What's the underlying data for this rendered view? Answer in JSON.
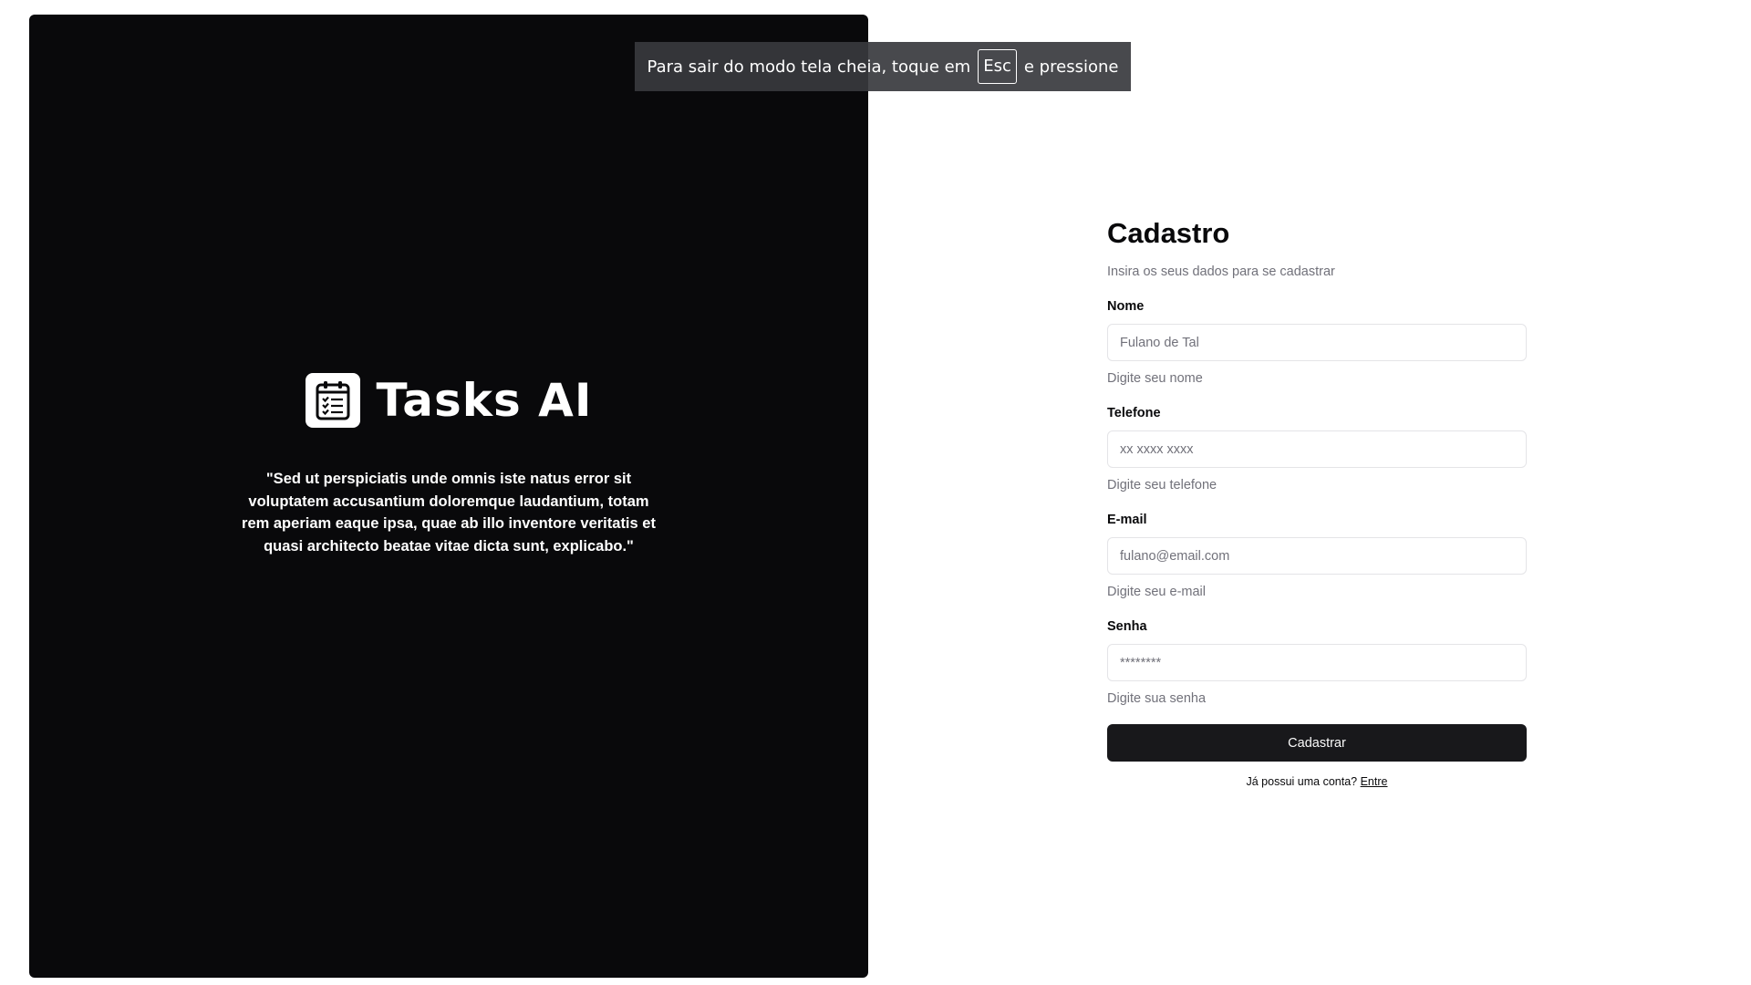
{
  "fullscreen_notice": {
    "text_before": "Para sair do modo tela cheia, toque em",
    "key": "Esc",
    "text_after": "e pressione"
  },
  "brand": {
    "name": "Tasks AI",
    "logo_icon": "clipboard-checklist-icon",
    "quote": "\"Sed ut perspiciatis unde omnis iste natus error sit voluptatem accusantium doloremque laudantium, totam rem aperiam eaque ipsa, quae ab illo inventore veritatis et quasi architecto beatae vitae dicta sunt, explicabo.\""
  },
  "form": {
    "title": "Cadastro",
    "subtitle": "Insira os seus dados para se cadastrar",
    "fields": [
      {
        "label": "Nome",
        "placeholder": "Fulano de Tal",
        "value": "",
        "hint": "Digite seu nome",
        "type": "text"
      },
      {
        "label": "Telefone",
        "placeholder": "xx xxxx xxxx",
        "value": "",
        "hint": "Digite seu telefone",
        "type": "tel"
      },
      {
        "label": "E-mail",
        "placeholder": "fulano@email.com",
        "value": "",
        "hint": "Digite seu e-mail",
        "type": "email"
      },
      {
        "label": "Senha",
        "placeholder": "********",
        "value": "",
        "hint": "Digite sua senha",
        "type": "password"
      }
    ],
    "submit_label": "Cadastrar",
    "login_prompt": "Já possui uma conta?",
    "login_link": "Entre"
  },
  "colors": {
    "panel_bg": "#09090b",
    "button_bg": "#18181b",
    "muted_text": "#71717a",
    "border": "#e4e4e7"
  }
}
